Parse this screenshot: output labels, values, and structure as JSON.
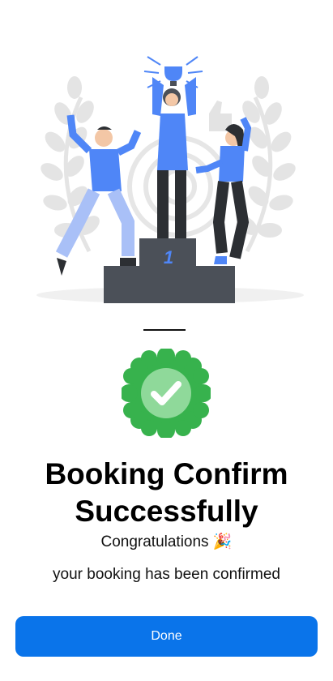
{
  "illustration": {
    "podium_rank": "1"
  },
  "success": {
    "title_line1": "Booking Confirm",
    "title_line2": "Successfully",
    "congrats": "Congratulations",
    "emoji": "🎉",
    "message": "your booking has been confirmed"
  },
  "actions": {
    "done_label": "Done"
  },
  "colors": {
    "accent": "#0a74ea",
    "success": "#37b24d",
    "figure_blue": "#4f86f7",
    "podium": "#4b5058"
  }
}
